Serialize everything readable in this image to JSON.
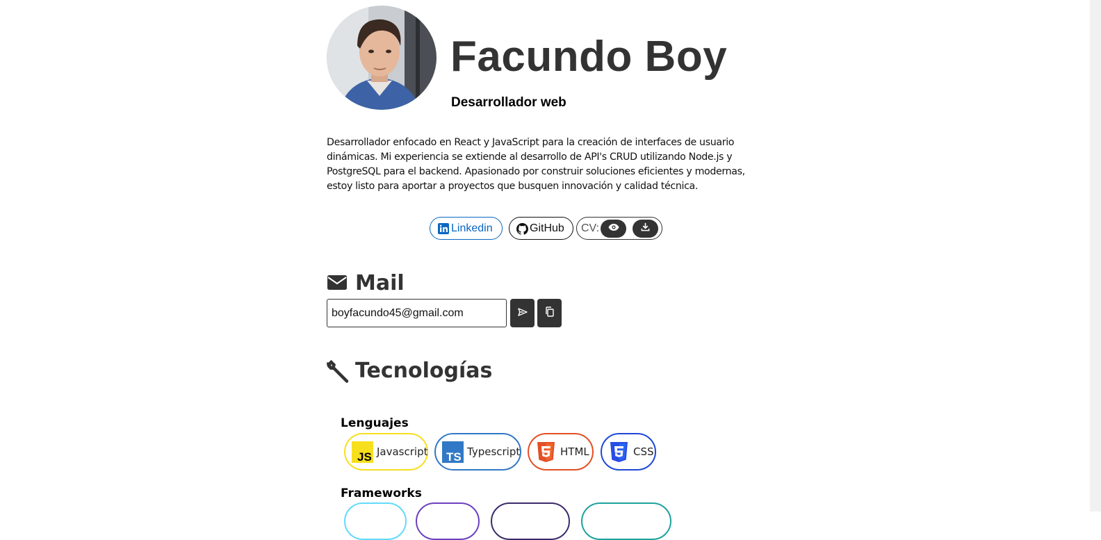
{
  "profile": {
    "name": "Facundo Boy",
    "role": "Desarrollador web",
    "bio": "Desarrollador enfocado en React y JavaScript para la creación de interfaces de usuario dinámicas. Mi experiencia se extiende al desarrollo de API's CRUD utilizando Node.js y PostgreSQL para el backend. Apasionado por construir soluciones eficientes y modernas, estoy listo para aportar a proyectos que busquen innovación y calidad técnica."
  },
  "links": {
    "linkedin_label": "Linkedin",
    "github_label": "GitHub",
    "cv_label": "CV:",
    "cv_view_icon": "eye-icon",
    "cv_download_icon": "download-icon"
  },
  "mail": {
    "title": "Mail",
    "icon": "envelope-icon",
    "email_value": "boyfacundo45@gmail.com",
    "send_icon": "send-icon",
    "copy_icon": "copy-icon"
  },
  "technologies": {
    "title": "Tecnologías",
    "icon": "wrench-icon",
    "categories": [
      {
        "label": "Lenguajes",
        "items": [
          {
            "name": "Javascript",
            "logo": "javascript-logo",
            "color": "#f7df1e"
          },
          {
            "name": "Typescript",
            "logo": "typescript-logo",
            "color": "#3178c6"
          },
          {
            "name": "HTML",
            "logo": "html5-logo",
            "color": "#e34f26"
          },
          {
            "name": "CSS",
            "logo": "css3-logo",
            "color": "#1e47d6"
          }
        ]
      },
      {
        "label": "Frameworks",
        "items": [
          {
            "color": "#61dafb"
          },
          {
            "color": "#6c3fc0"
          },
          {
            "color": "#3b2a6a"
          },
          {
            "color": "#1ba39c"
          }
        ]
      }
    ]
  },
  "colors": {
    "text": "#333333",
    "linkedin": "#0a66c2",
    "dark_button": "#333333"
  }
}
